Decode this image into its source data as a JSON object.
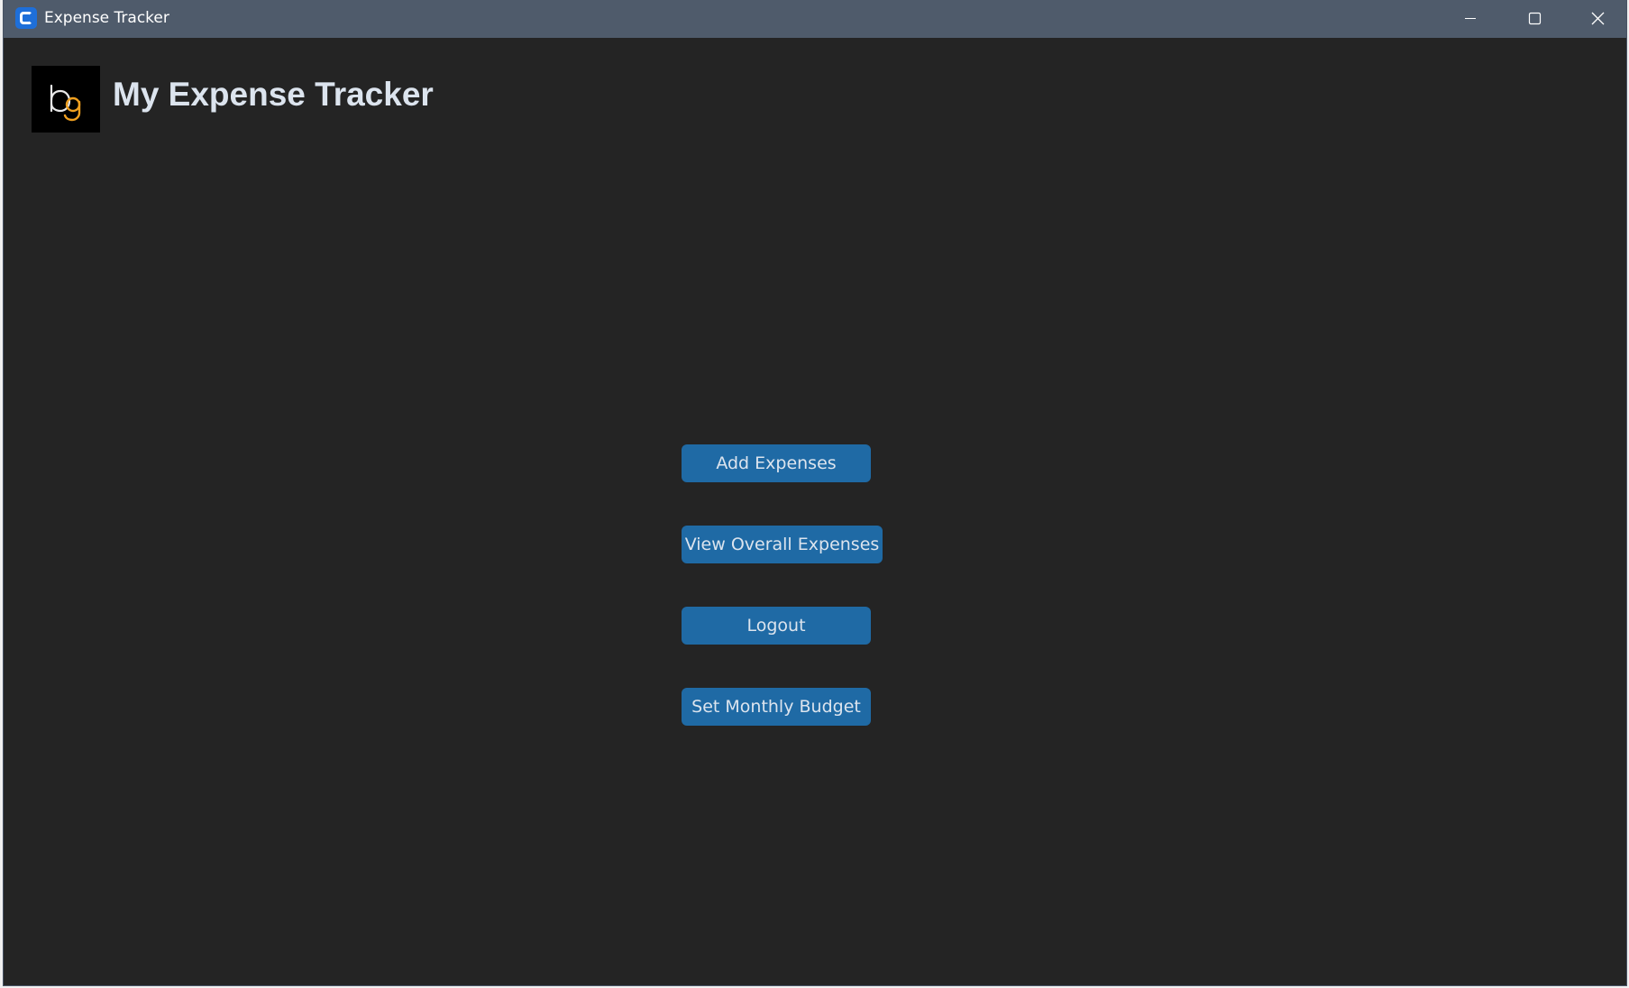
{
  "window": {
    "title": "Expense Tracker",
    "icon": "app-icon",
    "controls": {
      "minimize": "minimize-icon",
      "maximize": "maximize-icon",
      "close": "close-icon"
    }
  },
  "header": {
    "logo_text": "bg",
    "title": "My Expense Tracker"
  },
  "actions": {
    "add_expenses": "Add Expenses",
    "view_overall_expenses": "View Overall Expenses",
    "logout": "Logout",
    "set_monthly_budget": "Set Monthly Budget"
  },
  "colors": {
    "background": "#242424",
    "titlebar": "#4f5b6b",
    "button": "#1f6aa5",
    "text": "#dce4ee",
    "logo_accent": "#f0a020"
  }
}
